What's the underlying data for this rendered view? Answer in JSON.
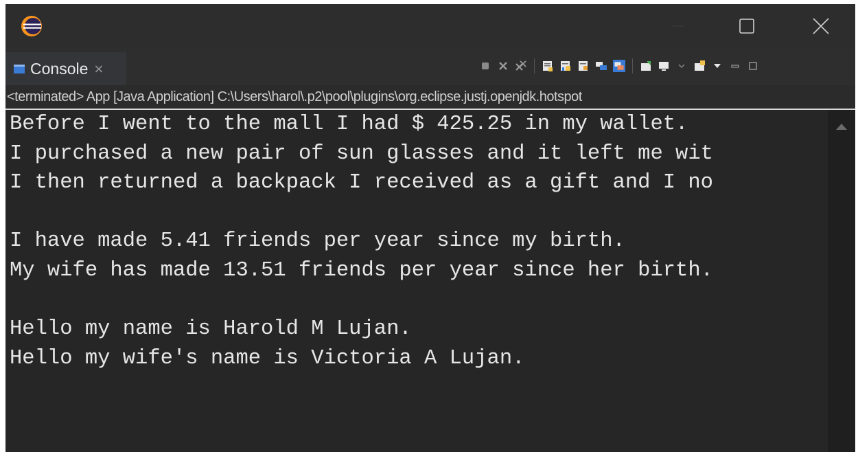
{
  "tab": {
    "label": "Console",
    "close": "×"
  },
  "status": "<terminated> App [Java Application] C:\\Users\\harol\\.p2\\pool\\plugins\\org.eclipse.justj.openjdk.hotspot",
  "output": [
    "Before I went to the mall I had $ 425.25 in my wallet.",
    "I purchased a new pair of sun glasses and it left me wit",
    "I then returned a backpack I received as a gift and I no",
    "",
    "I have made 5.41 friends per year since my birth.",
    "My wife has made 13.51 friends per year since her birth.",
    "",
    "Hello my name is Harold M Lujan.",
    "Hello my wife's name is Victoria A Lujan."
  ],
  "icons": {
    "app": "eclipse-icon",
    "window_buttons": [
      "minimize-icon",
      "maximize-icon",
      "close-icon"
    ],
    "toolbar": [
      "terminate-icon",
      "remove-launch-icon",
      "remove-all-terminated-icon",
      "clear-console-icon",
      "scroll-lock-icon",
      "word-wrap-icon",
      "show-on-stdout-icon",
      "show-on-stderr-icon",
      "pin-console-icon",
      "display-selected-console-icon",
      "open-console-icon",
      "minimize-view-icon",
      "maximize-view-icon"
    ]
  },
  "colors": {
    "background": "#262626",
    "text": "#e6e6e6",
    "accent": "#3a7bd5"
  }
}
